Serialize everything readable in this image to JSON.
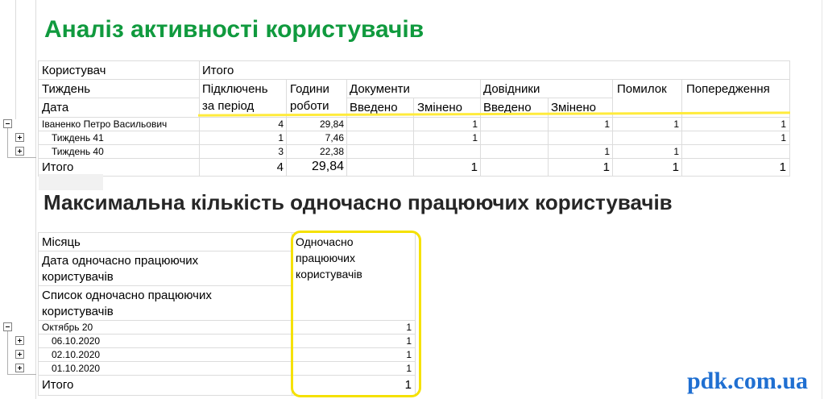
{
  "report1": {
    "title": "Аналіз активності користувачів",
    "header": {
      "user": "Користувач",
      "total": "Итого",
      "week": "Тиждень",
      "date": "Дата",
      "connections_line1": "Підключень",
      "connections_line2": "за період",
      "hours_line1": "Години",
      "hours_line2": "роботи",
      "documents": "Документи",
      "doc_entered": "Введено",
      "doc_changed": "Змінено",
      "references": "Довідники",
      "ref_entered": "Введено",
      "ref_changed": "Змінено",
      "errors": "Помилок",
      "warnings": "Попередження"
    },
    "rows": [
      {
        "label": "Іваненко Петро Васильович",
        "connections": "4",
        "hours": "29,84",
        "doc_entered": "",
        "doc_changed": "1",
        "ref_entered": "",
        "ref_changed": "1",
        "errors": "1",
        "warnings": "1"
      },
      {
        "label": "Тиждень 41",
        "connections": "1",
        "hours": "7,46",
        "doc_entered": "",
        "doc_changed": "1",
        "ref_entered": "",
        "ref_changed": "",
        "errors": "",
        "warnings": "1"
      },
      {
        "label": "Тиждень 40",
        "connections": "3",
        "hours": "22,38",
        "doc_entered": "",
        "doc_changed": "",
        "ref_entered": "",
        "ref_changed": "1",
        "errors": "1",
        "warnings": ""
      }
    ],
    "total": {
      "label": "Итого",
      "connections": "4",
      "hours": "29,84",
      "doc_entered": "",
      "doc_changed": "1",
      "ref_entered": "",
      "ref_changed": "1",
      "errors": "1",
      "warnings": "1"
    }
  },
  "report2": {
    "title": "Максимальна кількість одночасно працюючих користувачів",
    "header": {
      "month": "Місяць",
      "date_line1": "Дата одночасно працюючих",
      "date_line2": "користувачів",
      "list_line1": "Список одночасно працюючих",
      "list_line2": "користувачів",
      "col_line1": "Одночасно",
      "col_line2": "працюючих",
      "col_line3": "користувачів"
    },
    "rows": [
      {
        "label": "Октябрь 20",
        "value": "1"
      },
      {
        "label": "06.10.2020",
        "value": "1"
      },
      {
        "label": "02.10.2020",
        "value": "1"
      },
      {
        "label": "01.10.2020",
        "value": "1"
      }
    ],
    "total": {
      "label": "Итого",
      "value": "1"
    }
  },
  "watermark": "pdk.com.ua",
  "colors": {
    "title_green": "#109a3e",
    "highlight_yellow": "#ffeb3b",
    "watermark_blue": "#1f6fd1"
  }
}
